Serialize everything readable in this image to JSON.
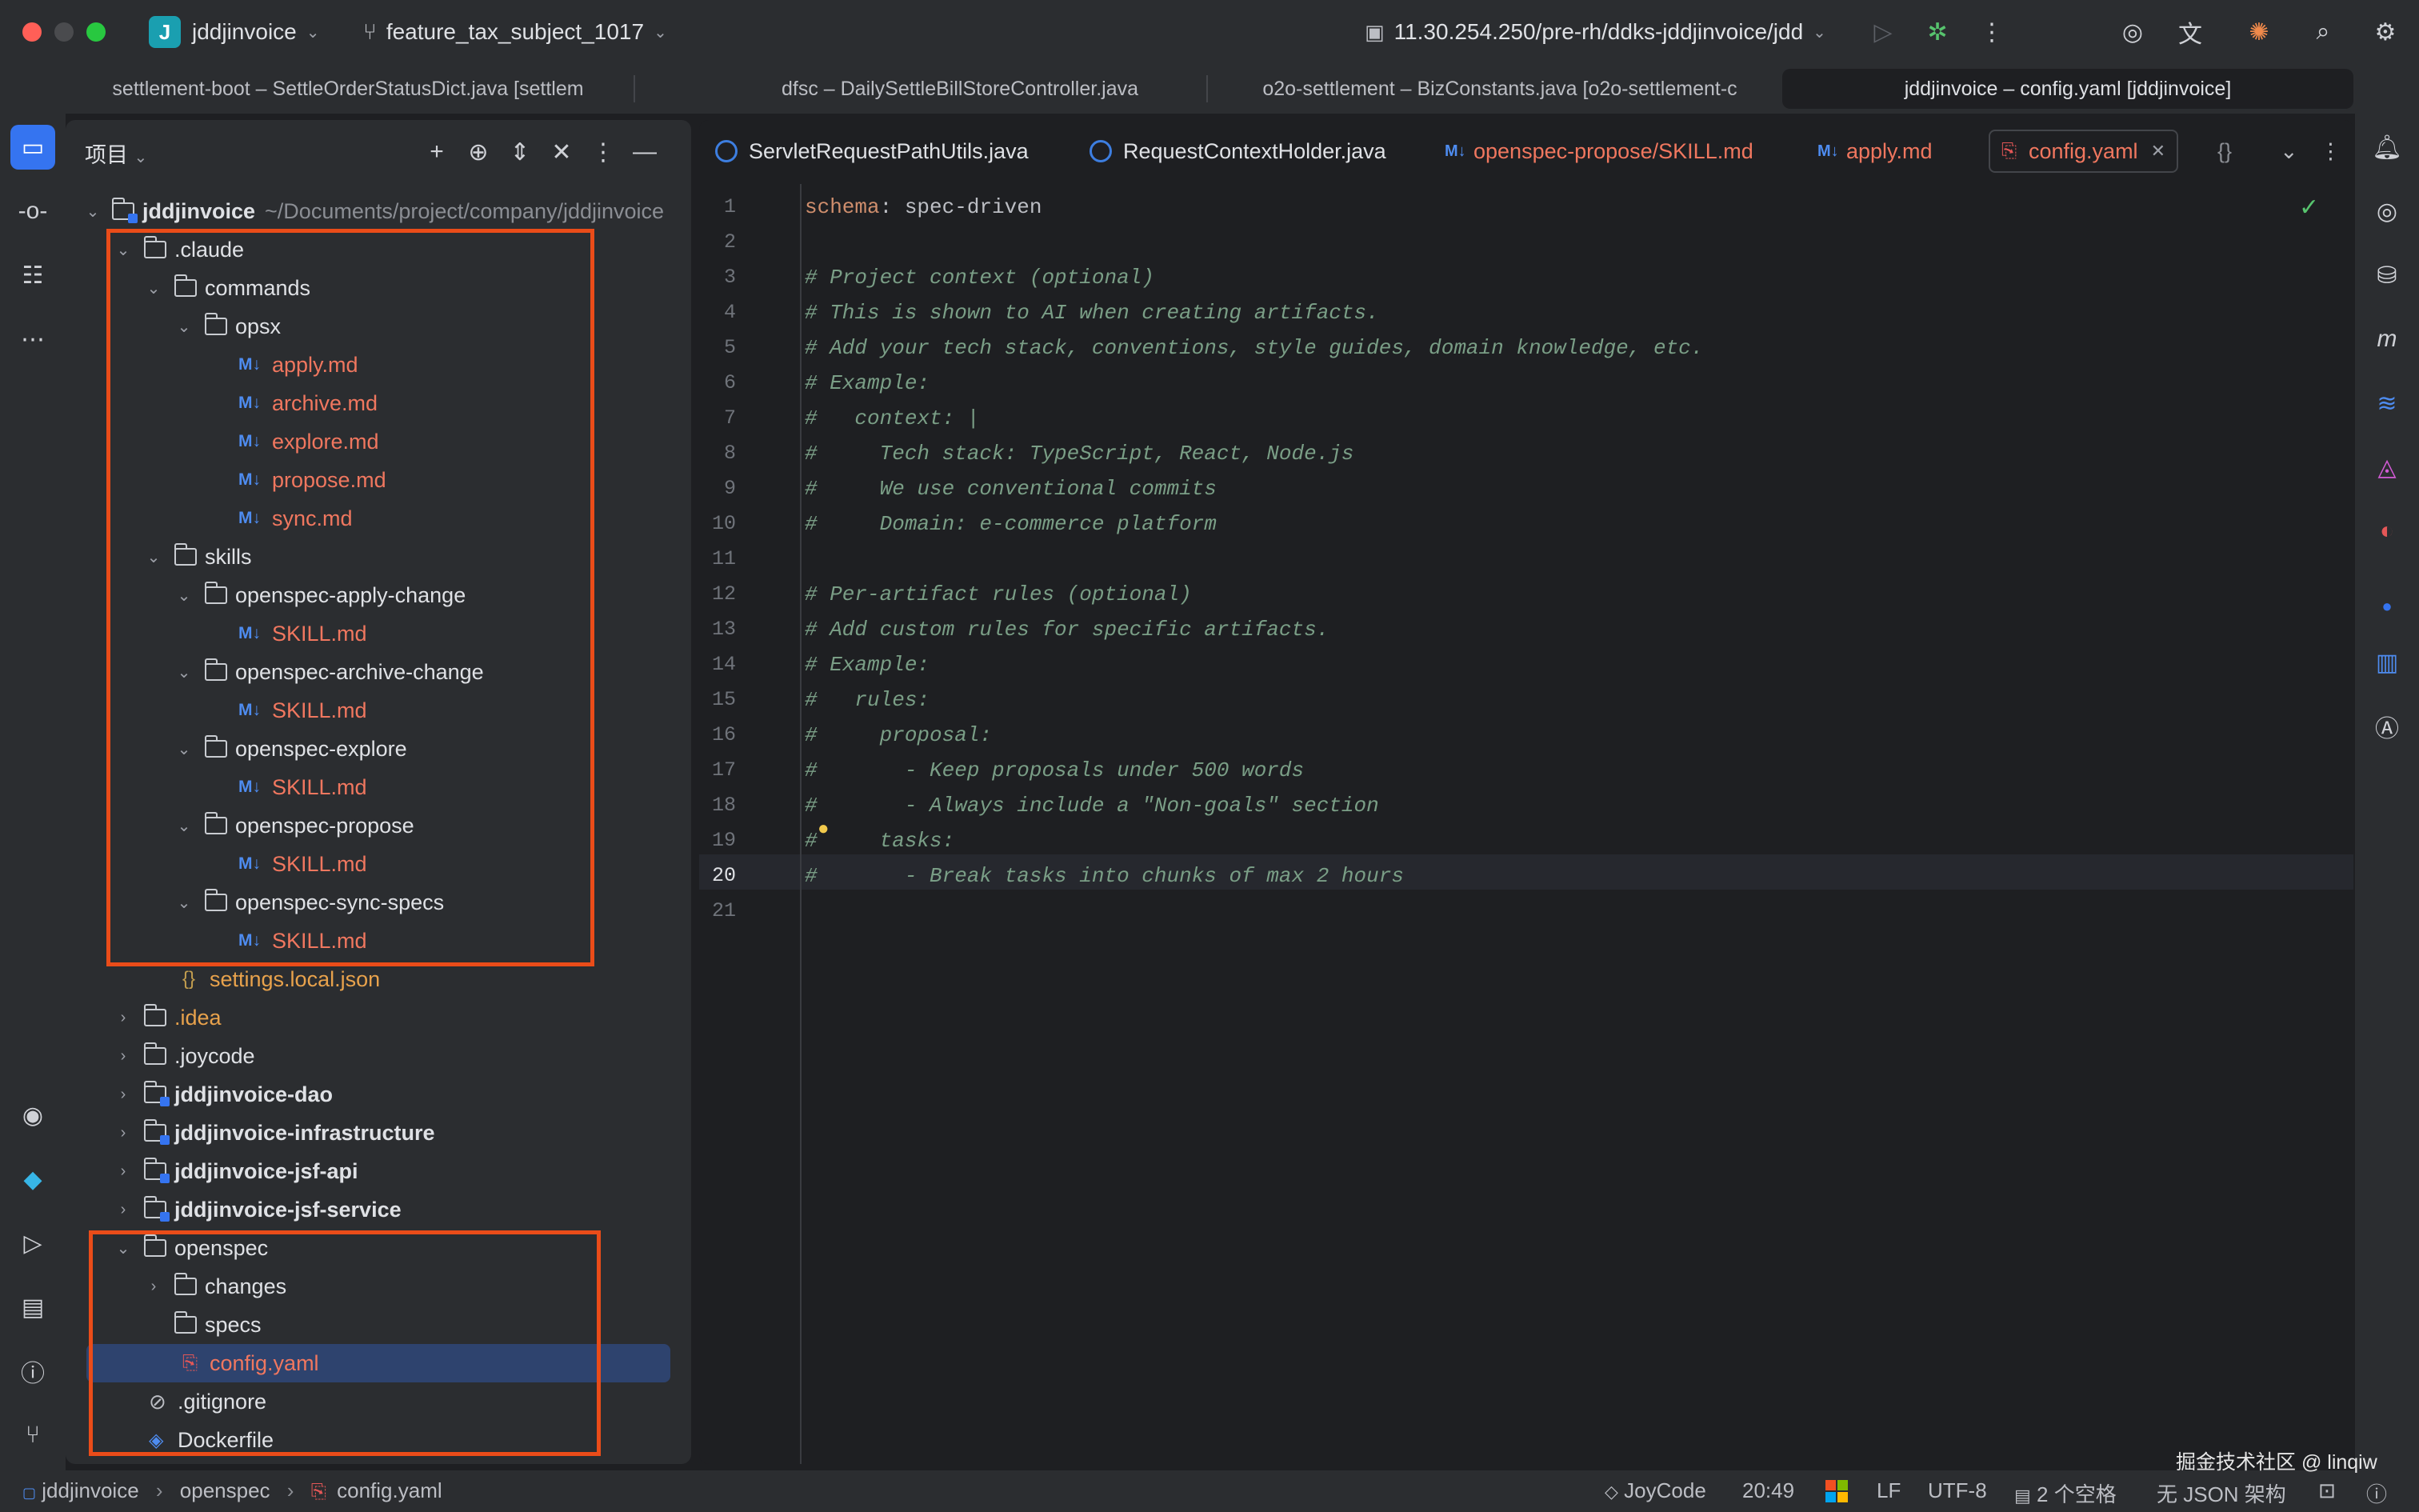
{
  "titlebar": {
    "project_badge": "J",
    "project_name": "jddjinvoice",
    "branch": "feature_tax_subject_1017",
    "run_config": "11.30.254.250/pre-rh/ddks-jddjinvoice/jdd"
  },
  "window_tabs": [
    "settlement-boot – SettleOrderStatusDict.java [settlem",
    "dfsc – DailySettleBillStoreController.java",
    "o2o-settlement – BizConstants.java [o2o-settlement-c",
    "jddjinvoice – config.yaml [jddjinvoice]"
  ],
  "project_panel": {
    "title": "项目",
    "root_name": "jddjinvoice",
    "root_path": "~/Documents/project/company/jddjinvoice",
    "claude": ".claude",
    "commands": "commands",
    "opsx": "opsx",
    "opsx_files": [
      "apply.md",
      "archive.md",
      "explore.md",
      "propose.md",
      "sync.md"
    ],
    "skills": "skills",
    "skill_dirs": [
      "openspec-apply-change",
      "openspec-archive-change",
      "openspec-explore",
      "openspec-propose",
      "openspec-sync-specs"
    ],
    "skill_file": "SKILL.md",
    "settings": "settings.local.json",
    "idea": ".idea",
    "joycode": ".joycode",
    "modules": [
      "jddjinvoice-dao",
      "jddjinvoice-infrastructure",
      "jddjinvoice-jsf-api",
      "jddjinvoice-jsf-service"
    ],
    "openspec": "openspec",
    "changes": "changes",
    "specs": "specs",
    "config": "config.yaml",
    "gitignore": ".gitignore",
    "dockerfile": "Dockerfile"
  },
  "editor_tabs": [
    "ServletRequestPathUtils.java",
    "RequestContextHolder.java",
    "openspec-propose/SKILL.md",
    "apply.md",
    "config.yaml"
  ],
  "code": {
    "line1_key": "schema",
    "line1_val": ": spec-driven",
    "comments": {
      "3": "# Project context (optional)",
      "4": "# This is shown to AI when creating artifacts.",
      "5": "# Add your tech stack, conventions, style guides, domain knowledge, etc.",
      "6": "# Example:",
      "7": "#   context: |",
      "8": "#     Tech stack: TypeScript, React, Node.js",
      "9": "#     We use conventional commits",
      "10": "#     Domain: e-commerce platform",
      "12": "# Per-artifact rules (optional)",
      "13": "# Add custom rules for specific artifacts.",
      "14": "# Example:",
      "15": "#   rules:",
      "16": "#     proposal:",
      "17": "#       - Keep proposals under 500 words",
      "18": "#       - Always include a \"Non-goals\" section",
      "19": "#     tasks:",
      "20": "#       - Break tasks into chunks of max 2 hours"
    },
    "line_numbers": [
      "1",
      "2",
      "3",
      "4",
      "5",
      "6",
      "7",
      "8",
      "9",
      "10",
      "11",
      "12",
      "13",
      "14",
      "15",
      "16",
      "17",
      "18",
      "19",
      "20",
      "21"
    ]
  },
  "statusbar": {
    "crumb_root": "jddjinvoice",
    "crumb_dir": "openspec",
    "crumb_file": "config.yaml",
    "plugin": "JoyCode",
    "position": "20:49",
    "line_sep": "LF",
    "encoding": "UTF-8",
    "indent": "2 个空格",
    "schema": "无 JSON 架构",
    "watermark": "掘金技术社区 @ linqiw"
  },
  "colors": {
    "accent": "#3574f0",
    "highlight_box": "#ea4c19",
    "comment": "#7a9e86",
    "yaml_key": "#cf8e6d"
  }
}
